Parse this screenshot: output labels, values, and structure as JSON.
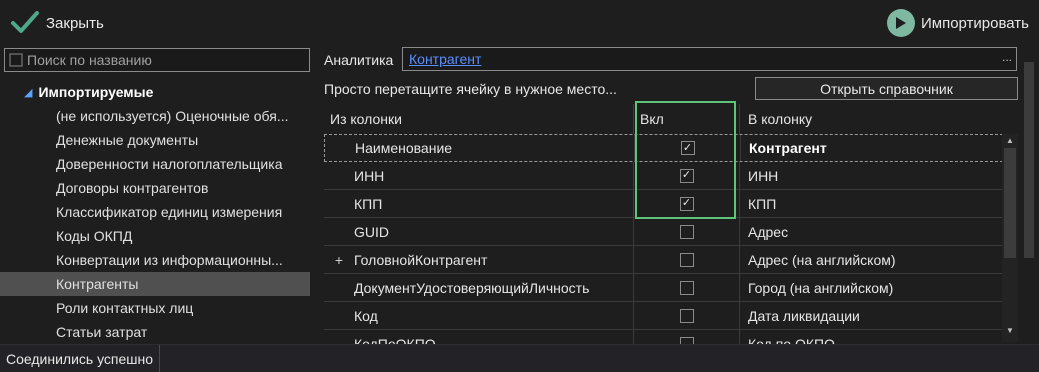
{
  "toolbar": {
    "close_label": "Закрыть",
    "import_label": "Импортировать"
  },
  "search": {
    "placeholder": "Поиск по названию"
  },
  "tree": {
    "group_label": "Импортируемые",
    "items": [
      "(не используется) Оценочные обя...",
      "Денежные документы",
      "Доверенности налогоплательщика",
      "Договоры контрагентов",
      "Классификатор единиц измерения",
      "Коды ОКПД",
      "Конвертации из информационны...",
      "Контрагенты",
      "Роли контактных лиц",
      "Статьи затрат"
    ],
    "selected": "Контрагенты"
  },
  "analytics": {
    "label": "Аналитика",
    "value": "Контрагент",
    "dots": "..."
  },
  "hint": "Просто перетащите ячейку в нужное место...",
  "open_directory_label": "Открыть справочник",
  "grid": {
    "headers": {
      "from": "Из колонки",
      "enabled": "Вкл",
      "to": "В колонку"
    },
    "rows": [
      {
        "expander": "",
        "from": "Наименование",
        "checked": true,
        "to": "Контрагент"
      },
      {
        "expander": "",
        "from": "ИНН",
        "checked": true,
        "to": "ИНН"
      },
      {
        "expander": "",
        "from": "КПП",
        "checked": true,
        "to": "КПП"
      },
      {
        "expander": "",
        "from": "GUID",
        "checked": false,
        "to": "Адрес"
      },
      {
        "expander": "+",
        "from": "ГоловнойКонтрагент",
        "checked": false,
        "to": "Адрес (на английском)"
      },
      {
        "expander": "",
        "from": "ДокументУдостоверяющийЛичность",
        "checked": false,
        "to": "Город (на английском)"
      },
      {
        "expander": "",
        "from": "Код",
        "checked": false,
        "to": "Дата ликвидации"
      },
      {
        "expander": "",
        "from": "КодПоОКПО",
        "checked": false,
        "to": "Код по ОКПО"
      }
    ]
  },
  "status": {
    "message": "Соединились успешно"
  },
  "colors": {
    "accent_check": "#4fa889",
    "play_button": "#7fb8a0",
    "highlight": "#5fc47a",
    "link": "#5a8fff"
  }
}
